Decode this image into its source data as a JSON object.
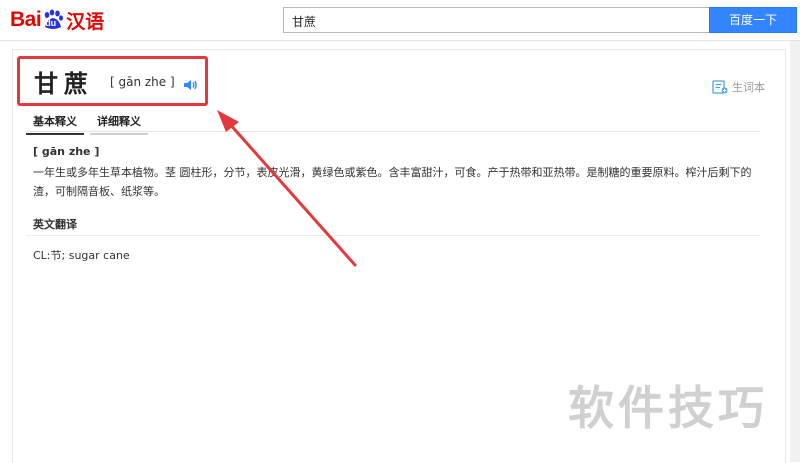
{
  "header": {
    "logo_bai": "Bai",
    "logo_du": "du",
    "logo_han": "汉语",
    "search_value": "甘蔗",
    "search_button": "百度一下"
  },
  "entry": {
    "word": "甘蔗",
    "pinyin": "[ gān zhe ]",
    "vocab_label": "生词本"
  },
  "tabs": [
    {
      "label": "基本释义"
    },
    {
      "label": "详细释义"
    }
  ],
  "definition": {
    "pinyin": "[ gān zhe ]",
    "text": "一年生或多年生草本植物。茎 圆柱形，分节，表皮光滑，黄绿色或紫色。含丰富甜汁，可食。产于热带和亚热带。是制糖的重要原料。榨汁后剩下的渣，可制隔音板、纸浆等。"
  },
  "translation": {
    "title": "英文翻译",
    "text": "CL:节; sugar cane"
  },
  "watermark": "软件技巧",
  "colors": {
    "brand_red": "#e10601",
    "search_blue": "#3385ff",
    "annotation_red": "#e4393c"
  },
  "icons": [
    "baidu-paw-icon",
    "speaker-icon",
    "vocabulary-book-icon"
  ]
}
